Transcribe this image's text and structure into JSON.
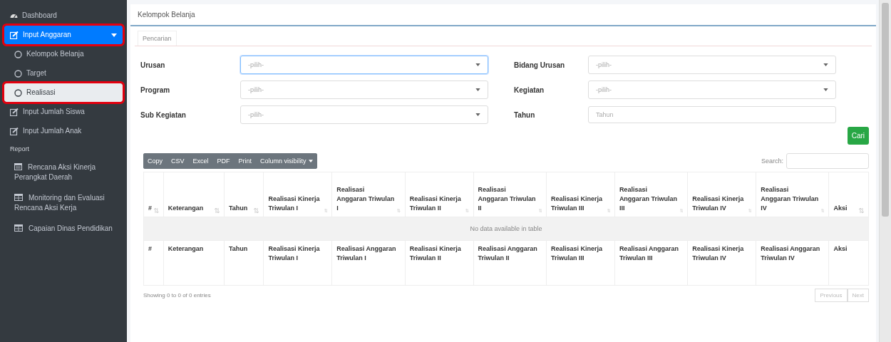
{
  "sidebar": {
    "items": [
      {
        "kind": "link",
        "label": "Dashboard",
        "selected": false,
        "highlighted": false
      },
      {
        "kind": "link",
        "label": "Input Anggaran",
        "selected": true,
        "highlighted": true,
        "expanded": true,
        "children": [
          {
            "label": "Kelompok Belanja",
            "selected": false,
            "highlighted": false
          },
          {
            "label": "Target",
            "selected": false,
            "highlighted": false
          },
          {
            "label": "Realisasi",
            "selected": true,
            "highlighted": true
          }
        ]
      },
      {
        "kind": "link",
        "label": "Input Jumlah Siswa",
        "selected": false,
        "highlighted": false
      },
      {
        "kind": "link",
        "label": "Input Jumlah Anak",
        "selected": false,
        "highlighted": false
      },
      {
        "kind": "header",
        "label": "Report"
      },
      {
        "kind": "link",
        "label": "Rencana Aksi Kinerja Perangkat Daerah",
        "selected": false,
        "highlighted": false
      },
      {
        "kind": "link",
        "label": "Monitoring dan Evaluasi Rencana Aksi Kerja",
        "selected": false,
        "highlighted": false
      },
      {
        "kind": "link",
        "label": "Capaian Dinas Pendidikan",
        "selected": false,
        "highlighted": false
      }
    ]
  },
  "card": {
    "title": "Kelompok Belanja",
    "tabs": [
      {
        "label": "Pencarian",
        "selected": true
      }
    ],
    "form": {
      "fields": [
        {
          "kind": "select",
          "label": "Urusan",
          "value": "-pilih-",
          "focused": true
        },
        {
          "kind": "select",
          "label": "Bidang Urusan",
          "value": "-pilih-",
          "focused": false
        },
        {
          "kind": "select",
          "label": "Program",
          "value": "-pilih-",
          "focused": false
        },
        {
          "kind": "select",
          "label": "Kegiatan",
          "value": "-pilih-",
          "focused": false
        },
        {
          "kind": "select",
          "label": "Sub Kegiatan",
          "value": "-pilih-",
          "focused": false
        },
        {
          "kind": "input",
          "label": "Tahun",
          "placeholder": "Tahun",
          "focused": false
        }
      ],
      "submit": "Cari"
    },
    "toolbar": [
      {
        "label": "Copy",
        "dropdown": false
      },
      {
        "label": "CSV",
        "dropdown": false
      },
      {
        "label": "Excel",
        "dropdown": false
      },
      {
        "label": "PDF",
        "dropdown": false
      },
      {
        "label": "Print",
        "dropdown": false
      },
      {
        "label": "Column visibility",
        "dropdown": true
      }
    ],
    "search_label": "Search:",
    "table": {
      "columns": [
        {
          "label": "#",
          "sortable": true
        },
        {
          "label": "Keterangan",
          "sortable": true
        },
        {
          "label": "Tahun",
          "sortable": true
        },
        {
          "label": "Realisasi Kinerja Triwulan I",
          "sortable": true
        },
        {
          "label": "Realisasi Anggaran Triwulan I",
          "sortable": true
        },
        {
          "label": "Realisasi Kinerja Triwulan II",
          "sortable": true
        },
        {
          "label": "Realisasi Anggaran Triwulan II",
          "sortable": true
        },
        {
          "label": "Realisasi Kinerja Triwulan III",
          "sortable": true
        },
        {
          "label": "Realisasi Anggaran Triwulan III",
          "sortable": true
        },
        {
          "label": "Realisasi Kinerja Triwulan IV",
          "sortable": true
        },
        {
          "label": "Realisasi Anggaran Triwulan IV",
          "sortable": true
        },
        {
          "label": "Aksi",
          "sortable": true
        }
      ],
      "empty_message": "No data available in table",
      "footer": [
        "#",
        "Keterangan",
        "Tahun",
        "Realisasi Kinerja Triwulan I",
        "Realisasi Anggaran Triwulan I",
        "Realisasi Kinerja Triwulan II",
        "Realisasi Anggaran Triwulan II",
        "Realisasi Kinerja Triwulan III",
        "Realisasi Anggaran Triwulan III",
        "Realisasi Kinerja Triwulan IV",
        "Realisasi Anggaran Triwulan IV",
        "Aksi"
      ]
    },
    "info": "Showing 0 to 0 of 0 entries",
    "pagination": [
      {
        "label": "Previous",
        "disabled": true
      },
      {
        "label": "Next",
        "disabled": true
      }
    ]
  }
}
